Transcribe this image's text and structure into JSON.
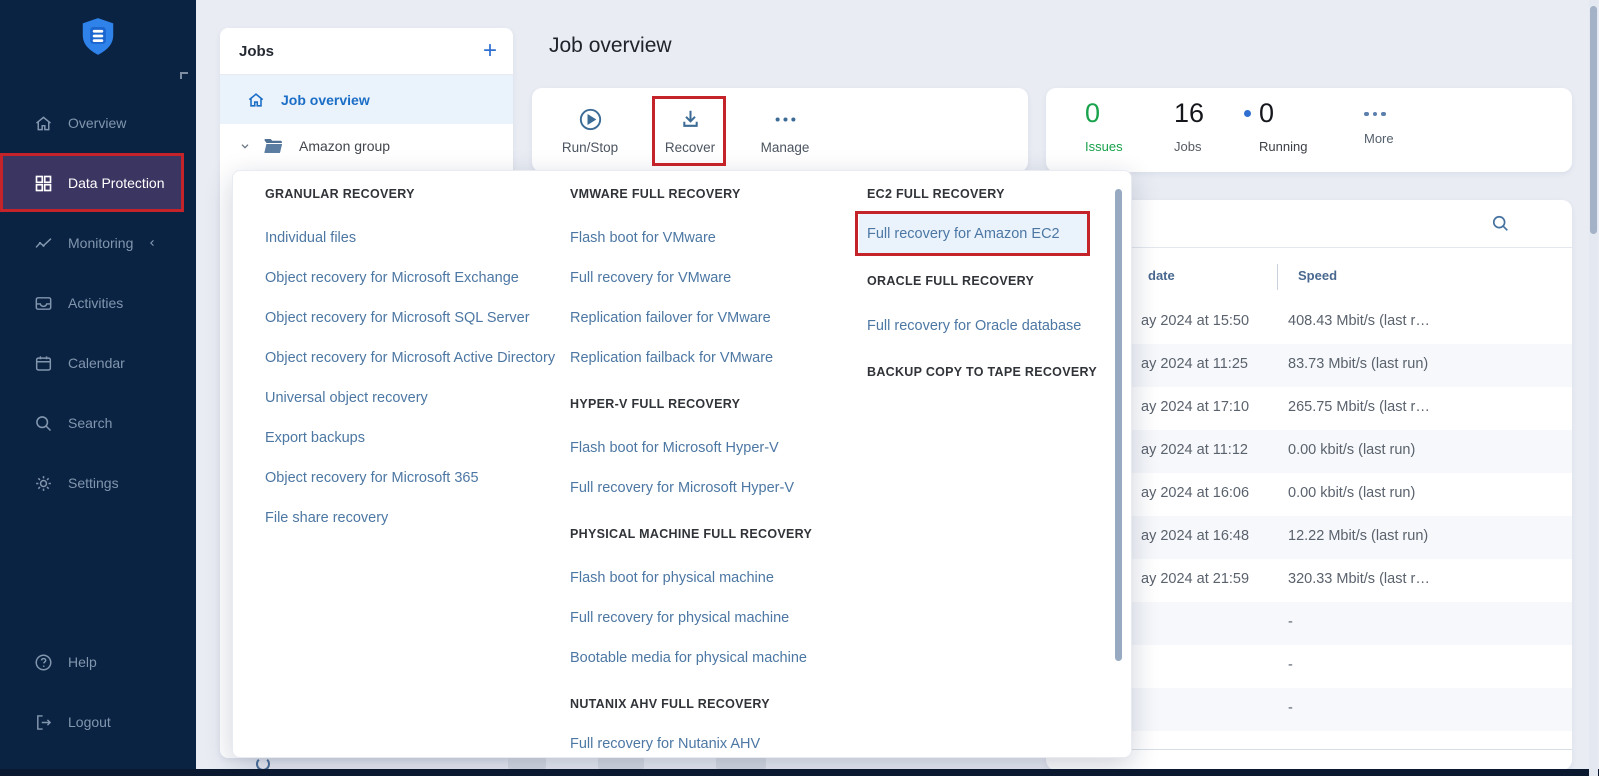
{
  "colors": {
    "annotation_red": "#c5232a",
    "accent_blue": "#2e6fd0",
    "issues_green": "#17a24b",
    "sidebar_bg": "#0a2342",
    "active_item_bg": "#3b3561"
  },
  "sidebar": {
    "items": [
      {
        "label": "Overview"
      },
      {
        "label": "Data Protection"
      },
      {
        "label": "Monitoring"
      },
      {
        "label": "Activities"
      },
      {
        "label": "Calendar"
      },
      {
        "label": "Search"
      },
      {
        "label": "Settings"
      },
      {
        "label": "Help"
      },
      {
        "label": "Logout"
      }
    ]
  },
  "jobs_panel": {
    "title": "Jobs",
    "add_button": "+",
    "items": [
      {
        "label": "Job overview"
      },
      {
        "label": "Amazon group"
      }
    ]
  },
  "main": {
    "title": "Job overview"
  },
  "actions": {
    "run_stop": "Run/Stop",
    "recover": "Recover",
    "manage": "Manage"
  },
  "stats": {
    "issues_value": "0",
    "issues_label": "Issues",
    "jobs_value": "16",
    "jobs_label": "Jobs",
    "running_value": "0",
    "running_label": "Running",
    "more_label": "More"
  },
  "recover_menu": {
    "columns": [
      {
        "sections": [
          {
            "header": "GRANULAR RECOVERY",
            "items": [
              {
                "label": "Individual files"
              },
              {
                "label": "Object recovery for Microsoft Exchange"
              },
              {
                "label": "Object recovery for Microsoft SQL Server"
              },
              {
                "label": "Object recovery for Microsoft Active Directory"
              },
              {
                "label": "Universal object recovery"
              },
              {
                "label": "Export backups"
              },
              {
                "label": "Object recovery for Microsoft 365"
              },
              {
                "label": "File share recovery"
              }
            ]
          }
        ]
      },
      {
        "sections": [
          {
            "header": "VMWARE FULL RECOVERY",
            "items": [
              {
                "label": "Flash boot for VMware"
              },
              {
                "label": "Full recovery for VMware"
              },
              {
                "label": "Replication failover for VMware"
              },
              {
                "label": "Replication failback for VMware"
              }
            ]
          },
          {
            "header": "HYPER-V FULL RECOVERY",
            "items": [
              {
                "label": "Flash boot for Microsoft Hyper-V"
              },
              {
                "label": "Full recovery for Microsoft Hyper-V"
              }
            ]
          },
          {
            "header": "PHYSICAL MACHINE FULL RECOVERY",
            "items": [
              {
                "label": "Flash boot for physical machine"
              },
              {
                "label": "Full recovery for physical machine"
              },
              {
                "label": "Bootable media for physical machine"
              }
            ]
          },
          {
            "header": "NUTANIX AHV FULL RECOVERY",
            "items": [
              {
                "label": "Full recovery for Nutanix AHV"
              }
            ]
          }
        ]
      },
      {
        "sections": [
          {
            "header": "EC2 FULL RECOVERY",
            "items": [
              {
                "label": "Full recovery for Amazon EC2",
                "highlighted": true
              }
            ]
          },
          {
            "header": "ORACLE FULL RECOVERY",
            "items": [
              {
                "label": "Full recovery for Oracle database"
              }
            ]
          },
          {
            "header": "BACKUP COPY TO TAPE RECOVERY",
            "items": []
          }
        ]
      }
    ]
  },
  "table": {
    "date_header": "date",
    "speed_header": "Speed",
    "rows": [
      {
        "date": "ay 2024 at 15:50",
        "speed": "408.43 Mbit/s (last r…"
      },
      {
        "date": "ay 2024 at 11:25",
        "speed": "83.73 Mbit/s (last run)"
      },
      {
        "date": "ay 2024 at 17:10",
        "speed": "265.75 Mbit/s (last r…"
      },
      {
        "date": "ay 2024 at 11:12",
        "speed": "0.00 kbit/s (last run)"
      },
      {
        "date": "ay 2024 at 16:06",
        "speed": "0.00 kbit/s (last run)"
      },
      {
        "date": "ay 2024 at 16:48",
        "speed": "12.22 Mbit/s (last run)"
      },
      {
        "date": "ay 2024 at 21:59",
        "speed": "320.33 Mbit/s (last r…"
      },
      {
        "date": "",
        "speed": "-"
      },
      {
        "date": "",
        "speed": "-"
      },
      {
        "date": "",
        "speed": "-"
      }
    ]
  }
}
